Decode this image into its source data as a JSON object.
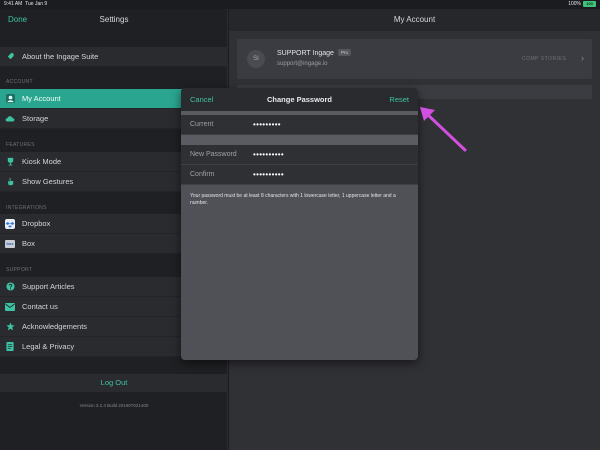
{
  "status_bar": {
    "time": "9:41 AM",
    "date": "Tue Jan 9",
    "battery_pct": "100%",
    "battery_label": "100"
  },
  "sidebar": {
    "done_label": "Done",
    "title": "Settings",
    "about": "About the Ingage Suite",
    "sections": {
      "account": "ACCOUNT",
      "features": "FEATURES",
      "integrations": "INTEGRATIONS",
      "support": "SUPPORT"
    },
    "items": {
      "my_account": "My Account",
      "storage": "Storage",
      "kiosk": "Kiosk Mode",
      "gestures": "Show Gestures",
      "dropbox": "Dropbox",
      "box": "Box",
      "box_icon": "box",
      "support_articles": "Support Articles",
      "contact": "Contact us",
      "ack": "Acknowledgements",
      "legal": "Legal & Privacy"
    },
    "logout": "Log Out",
    "version": "Version 3.2.4 Build 201907021400"
  },
  "main": {
    "title": "My Account",
    "account": {
      "initials": "SI",
      "name": "SUPPORT Ingage",
      "badge": "Pro",
      "email": "support@ingage.io",
      "comp_label": "COMP STORIES"
    }
  },
  "modal": {
    "cancel": "Cancel",
    "title": "Change Password",
    "reset": "Reset",
    "fields": [
      {
        "label": "Current",
        "value": "•••••••••"
      },
      {
        "label": "New Password",
        "value": "••••••••••"
      },
      {
        "label": "Confirm",
        "value": "••••••••••"
      }
    ],
    "note": "Your password must be at least 8 characters with 1 lowercase letter, 1 uppercase letter and a number."
  },
  "colors": {
    "accent": "#3ec2a4",
    "active_row": "#2aa58f",
    "annotation_arrow": "#d24fe0"
  },
  "icons": [
    "rocket-icon",
    "person-icon",
    "cloud-icon",
    "trophy-icon",
    "hand-icon",
    "dropbox-icon",
    "box-icon",
    "question-icon",
    "mail-icon",
    "star-icon",
    "document-icon",
    "chevron-right-icon",
    "arrow-pointer-icon"
  ]
}
